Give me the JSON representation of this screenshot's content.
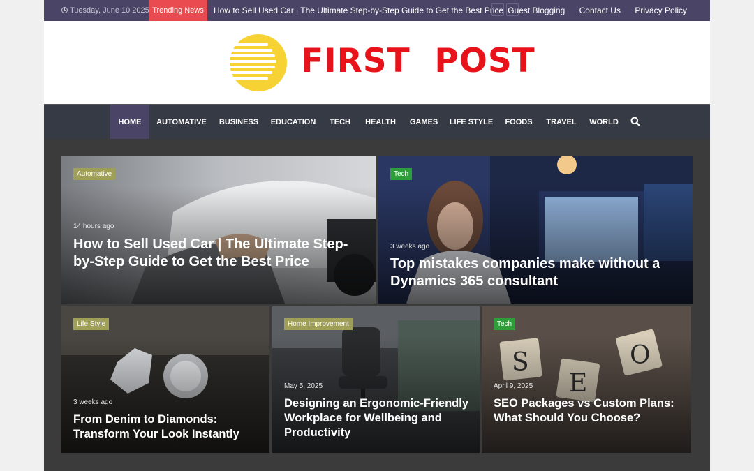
{
  "topbar": {
    "date": "Tuesday, June 10 2025",
    "trending_label": "Trending News",
    "ticker_text": "How to Sell Used Car | The Ultimate Step-by-Step Guide to Get the Best Price",
    "prev_arrow": "‹",
    "next_arrow": "›",
    "links": [
      "Guest Blogging",
      "Contact Us",
      "Privacy Policy"
    ]
  },
  "header": {
    "logo_text": "FIRST  POST",
    "logo_colors": {
      "mark": "#f7d234",
      "text": "#e8131a"
    }
  },
  "nav": {
    "items": [
      "HOME",
      "AUTOMATIVE",
      "BUSINESS",
      "EDUCATION",
      "TECH",
      "HEALTH",
      "GAMES",
      "LIFE STYLE",
      "FOODS",
      "TRAVEL",
      "WORLD"
    ],
    "active": "HOME",
    "search_icon": "search-icon"
  },
  "posts": [
    {
      "category": "Automative",
      "meta": "14 hours ago",
      "title": "How to Sell Used Car | The Ultimate Step-by-Step Guide to Get the Best Price"
    },
    {
      "category": "Tech",
      "meta": "3 weeks ago",
      "title": "Top mistakes companies make without a Dynamics 365 consultant"
    },
    {
      "category": "Life Style",
      "meta": "3 weeks ago",
      "title": "From Denim to Diamonds: Transform Your Look Instantly"
    },
    {
      "category": "Home Improvement",
      "meta": "May 5, 2025",
      "title": "Designing an Ergonomic-Friendly Workplace for Wellbeing and Productivity"
    },
    {
      "category": "Tech",
      "meta": "April 9, 2025",
      "title": "SEO Packages vs Custom Plans: What Should You Choose?"
    }
  ],
  "colors": {
    "topbar": "#4a4566",
    "trending": "#e94b50",
    "nav": "#363a45",
    "tag_olive": "#9f9f58",
    "tag_green": "#2e9e3b"
  }
}
